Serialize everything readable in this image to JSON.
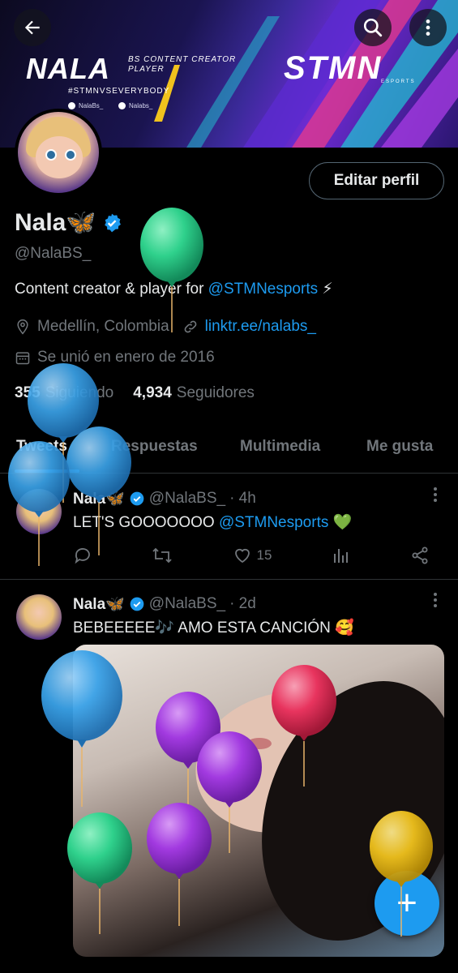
{
  "banner": {
    "name": "NALA",
    "subtitle_line1": "BS CONTENT CREATOR",
    "subtitle_line2": "PLAYER",
    "hashtag": "#STMNVSEVERYBODY",
    "twitter_handle": "NalaBs_",
    "other_handle": "Nalabs_",
    "brand": "STMN",
    "brand_sub": "ESPORTS"
  },
  "profile": {
    "edit_button": "Editar perfil",
    "display_name": "Nala🦋",
    "handle": "@NalaBS_",
    "bio_text": "Content creator & player for ",
    "bio_mention": "@STMNesports",
    "bio_emoji": " ⚡",
    "location": "Medellín, Colombia",
    "website": "linktr.ee/nalabs_",
    "joined": "Se unió en enero de 2016",
    "following_count": "355",
    "following_label": "Siguiendo",
    "followers_count": "4,934",
    "followers_label": "Seguidores"
  },
  "tabs": [
    "Tweets",
    "Respuestas",
    "Multimedia",
    "Me gusta"
  ],
  "tweets": [
    {
      "name": "Nala🦋",
      "handle": "@NalaBS_",
      "time": "· 4h",
      "text": "LET'S GOOOOOOO ",
      "mention": "@STMNesports",
      "text_end": " 💚",
      "likes": "15"
    },
    {
      "name": "Nala🦋",
      "handle": "@NalaBS_",
      "time": "· 2d",
      "text": "BEBEEEEE🎶 AMO ESTA CANCIÓN 🥰"
    }
  ],
  "fab_label": "+",
  "colors": {
    "accent": "#1d9bf0",
    "background": "#000000",
    "muted": "#71767b",
    "balloon_green": "#2fd18c",
    "balloon_blue": "#3aa2e8",
    "balloon_purple": "#a23ae0",
    "balloon_pink": "#e8345e",
    "balloon_yellow": "#f0c21d"
  }
}
